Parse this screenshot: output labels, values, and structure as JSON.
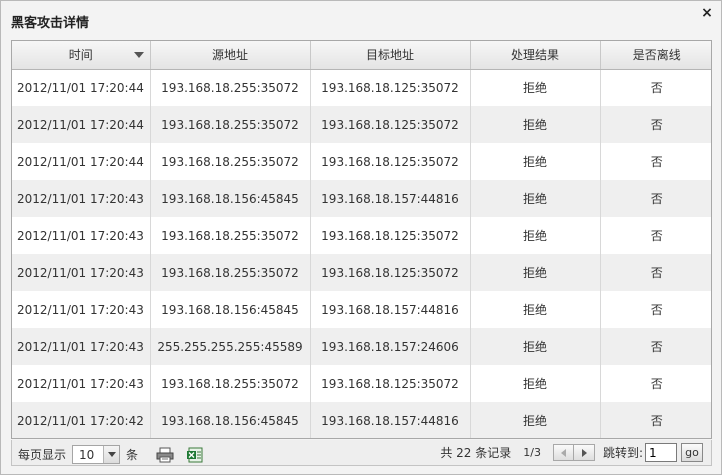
{
  "dialog": {
    "title": "黑客攻击详情",
    "close_label": "×"
  },
  "table": {
    "columns": [
      "时间",
      "源地址",
      "目标地址",
      "处理结果",
      "是否离线"
    ],
    "rows": [
      [
        "2012/11/01 17:20:44",
        "193.168.18.255:35072",
        "193.168.18.125:35072",
        "拒绝",
        "否"
      ],
      [
        "2012/11/01 17:20:44",
        "193.168.18.255:35072",
        "193.168.18.125:35072",
        "拒绝",
        "否"
      ],
      [
        "2012/11/01 17:20:44",
        "193.168.18.255:35072",
        "193.168.18.125:35072",
        "拒绝",
        "否"
      ],
      [
        "2012/11/01 17:20:43",
        "193.168.18.156:45845",
        "193.168.18.157:44816",
        "拒绝",
        "否"
      ],
      [
        "2012/11/01 17:20:43",
        "193.168.18.255:35072",
        "193.168.18.125:35072",
        "拒绝",
        "否"
      ],
      [
        "2012/11/01 17:20:43",
        "193.168.18.255:35072",
        "193.168.18.125:35072",
        "拒绝",
        "否"
      ],
      [
        "2012/11/01 17:20:43",
        "193.168.18.156:45845",
        "193.168.18.157:44816",
        "拒绝",
        "否"
      ],
      [
        "2012/11/01 17:20:43",
        "255.255.255.255:45589",
        "193.168.18.157:24606",
        "拒绝",
        "否"
      ],
      [
        "2012/11/01 17:20:43",
        "193.168.18.255:35072",
        "193.168.18.125:35072",
        "拒绝",
        "否"
      ],
      [
        "2012/11/01 17:20:42",
        "193.168.18.156:45845",
        "193.168.18.157:44816",
        "拒绝",
        "否"
      ]
    ]
  },
  "footer": {
    "per_page_label": "每页显示",
    "page_size": "10",
    "unit_label": "条",
    "total_text": "共 22 条记录",
    "page_info": "1/3",
    "jump_label": "跳转到:",
    "jump_value": "1",
    "go_label": "go"
  },
  "icons": {
    "print": "printer-icon",
    "export": "excel-icon"
  }
}
